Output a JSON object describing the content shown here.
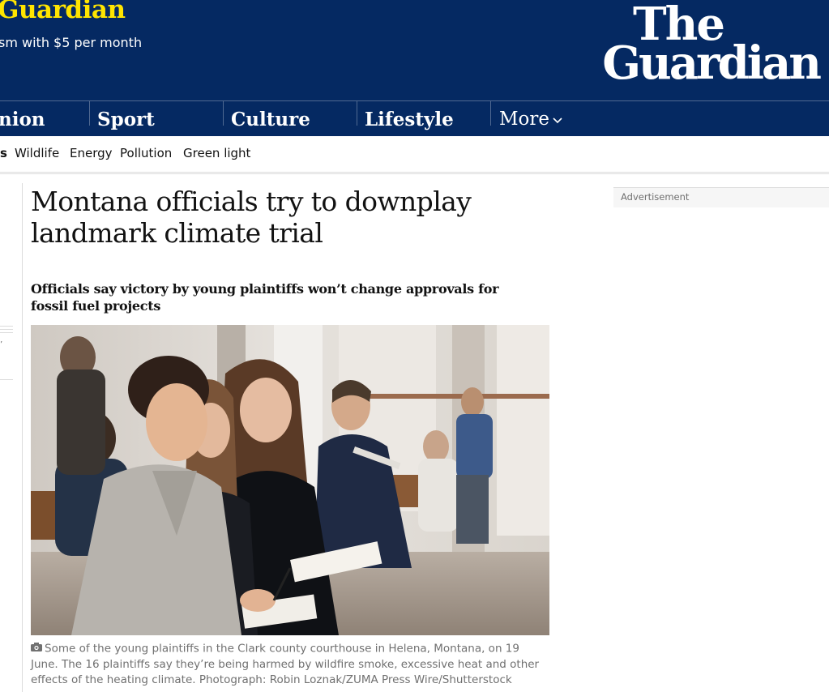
{
  "masthead": {
    "support_title": "Guardian",
    "support_subtitle": "sm with $5 per month",
    "logo_line1": "The",
    "logo_line2": "Guardian",
    "bg_color": "#052962",
    "accent_color": "#ffe500"
  },
  "pillars": {
    "items": [
      {
        "label": "nion"
      },
      {
        "label": "Sport"
      },
      {
        "label": "Culture"
      },
      {
        "label": "Lifestyle"
      }
    ],
    "more_label": "More",
    "more_icon": "chevron-down-icon"
  },
  "subnav": {
    "items": [
      {
        "label": "s"
      },
      {
        "label": "Wildlife"
      },
      {
        "label": "Energy"
      },
      {
        "label": "Pollution"
      },
      {
        "label": "Green light"
      }
    ]
  },
  "article": {
    "headline": "Montana officials try to downplay landmark climate trial",
    "standfirst": "Officials say victory by young plaintiffs won’t change approvals for fossil fuel projects",
    "caption": "Some of the young plaintiffs in the Clark county courthouse in Helena, Montana, on 19 June. The 16 plaintiffs say they’re being harmed by wildfire smoke, excessive heat and other effects of the heating climate. Photograph: Robin Loznak/ZUMA Press Wire/Shutterstock",
    "caption_icon": "camera-icon"
  },
  "sidebar": {
    "ad_label": "Advertisement"
  },
  "left_fragment": {
    "tick": "’"
  }
}
